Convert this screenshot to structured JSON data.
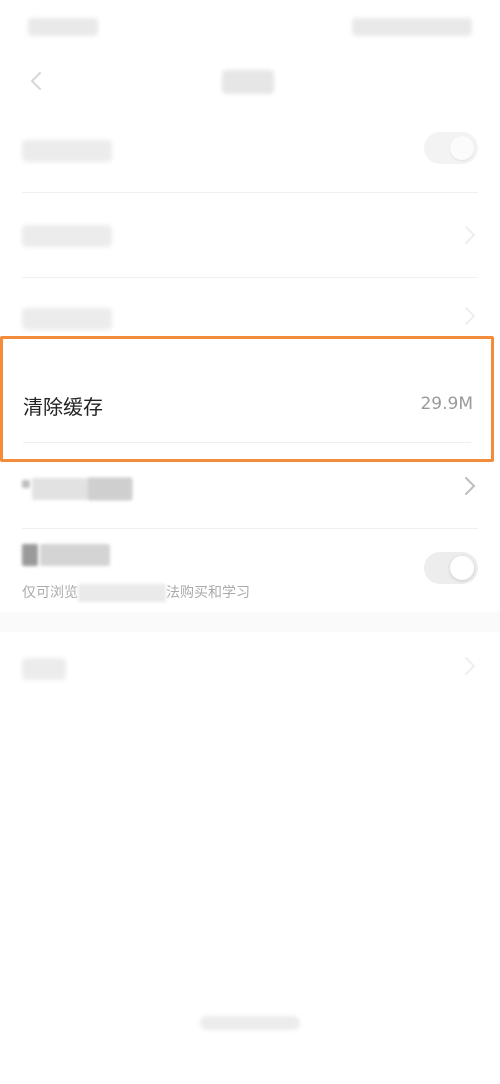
{
  "settings": {
    "clear_cache": {
      "label": "清除缓存",
      "size": "29.9M"
    },
    "restricted_mode": {
      "description_prefix": "仅可浏览",
      "description_suffix": "法购买和学习"
    }
  },
  "colors": {
    "highlight": "#f28c3a",
    "secondary_text": "#9a9a9a",
    "primary_text": "#222222"
  }
}
